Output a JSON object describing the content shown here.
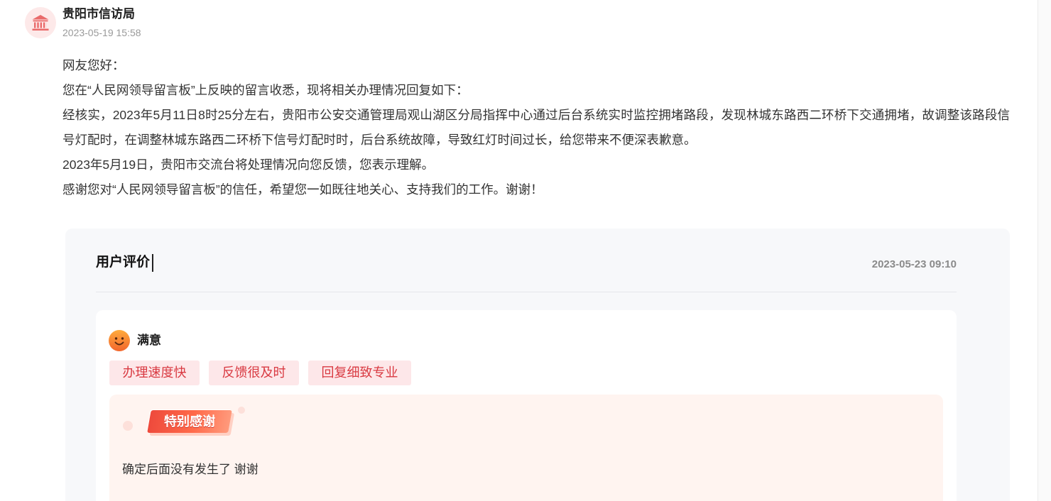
{
  "reply": {
    "avatar_icon": "government-building-icon",
    "author": "贵阳市信访局",
    "time": "2023-05-19 15:58",
    "paragraphs": [
      "网友您好：",
      "您在“人民网领导留言板”上反映的留言收悉，现将相关办理情况回复如下：",
      "经核实，2023年5月11日8时25分左右，贵阳市公安交通管理局观山湖区分局指挥中心通过后台系统实时监控拥堵路段，发现林城东路西二环桥下交通拥堵，故调整该路段信号灯配时，在调整林城东路西二环桥下信号灯配时时，后台系统故障，导致红灯时间过长，给您带来不便深表歉意。",
      "2023年5月19日，贵阳市交流台将处理情况向您反馈，您表示理解。",
      "感谢您对“人民网领导留言板”的信任，希望您一如既往地关心、支持我们的工作。谢谢！"
    ]
  },
  "evaluation": {
    "title": "用户评价",
    "time": "2023-05-23 09:10",
    "rating": {
      "icon": "smiley-icon",
      "label": "满意"
    },
    "tags": [
      "办理速度快",
      "反馈很及时",
      "回复细致专业"
    ],
    "thanks_badge": "特别感谢",
    "comment": "确定后面没有发生了 谢谢"
  },
  "colors": {
    "avatar_bg": "#fde9e9",
    "avatar_icon": "#e96a6a",
    "panel_bg": "#f7f8fa",
    "tag_bg": "#fde7e9",
    "tag_text": "#d93a42",
    "thanks_bg": "#fff4f0",
    "badge_red": "#ee4a3c",
    "smiley_orange": "#f7842f"
  }
}
